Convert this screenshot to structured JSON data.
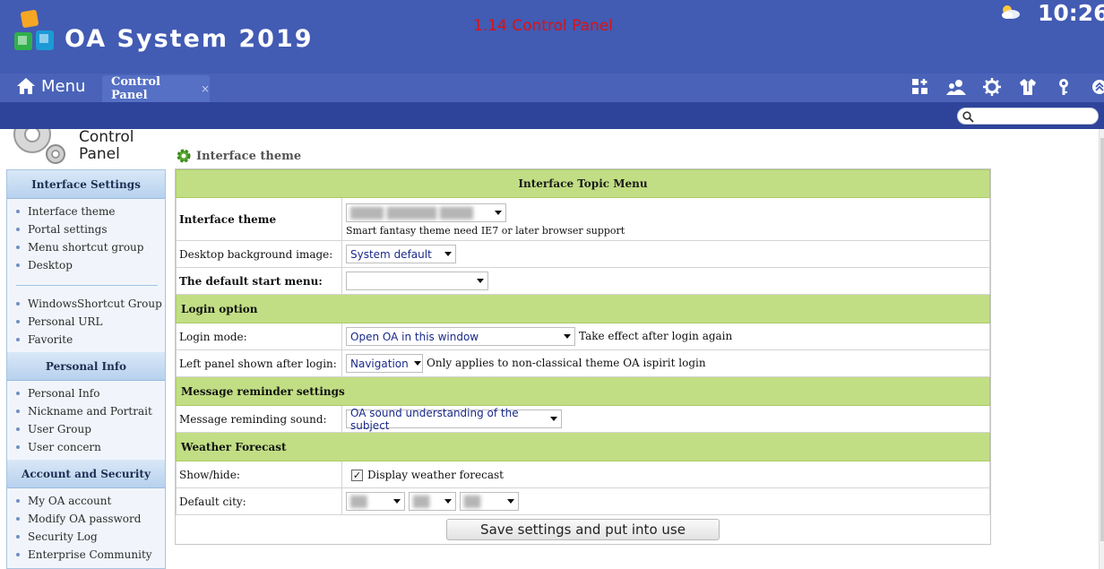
{
  "app": {
    "title": "OA System 2019",
    "page_heading": "1.14 Control Panel",
    "clock": "10:26"
  },
  "nav": {
    "menu_label": "Menu",
    "tab_label": "Control Panel",
    "tab_close": "×",
    "toolbar_icons": [
      "apps-add-icon",
      "users-icon",
      "settings-icon",
      "shirt-icon",
      "key-icon",
      "collapse-up-icon"
    ]
  },
  "search": {
    "placeholder": ""
  },
  "sidebar": {
    "title": "Control Panel",
    "sections": [
      {
        "heading": "Interface Settings",
        "groups": [
          [
            "Interface theme",
            "Portal settings",
            "Menu shortcut group",
            "Desktop"
          ],
          [
            "WindowsShortcut Group",
            "Personal URL",
            "Favorite"
          ]
        ]
      },
      {
        "heading": "Personal Info",
        "groups": [
          [
            "Personal Info",
            "Nickname and Portrait",
            "User Group",
            "User concern"
          ]
        ]
      },
      {
        "heading": "Account and Security",
        "groups": [
          [
            "My OA account",
            "Modify OA password",
            "Security Log",
            "Enterprise Community"
          ]
        ]
      }
    ]
  },
  "main": {
    "title": "Interface theme",
    "table_header": "Interface Topic Menu",
    "interface_theme": {
      "label": "Interface theme",
      "value": "████ ██████ ████",
      "note": "Smart fantasy theme need IE7 or later browser support"
    },
    "desktop_bg": {
      "label": "Desktop background image:",
      "value": "System default"
    },
    "start_menu": {
      "label": "The default start menu:",
      "value": ""
    },
    "login_section": "Login option",
    "login_mode": {
      "label": "Login mode:",
      "value": "Open OA in this window",
      "note": "Take effect after login again"
    },
    "left_panel": {
      "label": "Left panel shown after login:",
      "value": "Navigation",
      "note": "Only applies to non-classical theme OA ispirit login"
    },
    "message_section": "Message reminder settings",
    "message_sound": {
      "label": "Message reminding sound:",
      "value": "OA sound understanding of the subject"
    },
    "weather_section": "Weather Forecast",
    "show_hide": {
      "label": "Show/hide:",
      "checkbox_label": "Display weather forecast",
      "checked": true,
      "check_mark": "✓"
    },
    "default_city": {
      "label": "Default city:",
      "values": [
        "██",
        "██",
        "██"
      ]
    },
    "save_label": "Save settings and put into use"
  },
  "colors": {
    "header": "#425bb3",
    "subbar": "#2e449a",
    "group_green": "#c1de84",
    "heading_red": "#e01010"
  }
}
